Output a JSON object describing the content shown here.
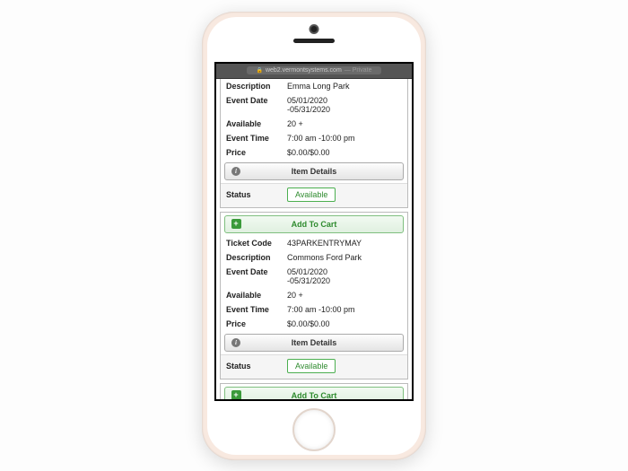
{
  "address_bar": {
    "lock_icon": "lock-icon",
    "host": "web2.vermontsystems.com",
    "private_tag": "— Private"
  },
  "labels": {
    "ticket_code": "Ticket Code",
    "description": "Description",
    "event_date": "Event Date",
    "available": "Available",
    "event_time": "Event Time",
    "price": "Price",
    "item_details": "Item Details",
    "status": "Status",
    "add_to_cart": "Add To Cart"
  },
  "items": [
    {
      "description": "Emma Long Park",
      "event_date_from": "05/01/2020",
      "event_date_to": "-05/31/2020",
      "available": "20 +",
      "event_time": "7:00 am -10:00 pm",
      "price": "$0.00/$0.00",
      "status": "Available"
    },
    {
      "ticket_code": "43PARKENTRYMAY",
      "description": "Commons Ford Park",
      "event_date_from": "05/01/2020",
      "event_date_to": "-05/31/2020",
      "available": "20 +",
      "event_time": "7:00 am -10:00 pm",
      "price": "$0.00/$0.00",
      "status": "Available"
    }
  ]
}
